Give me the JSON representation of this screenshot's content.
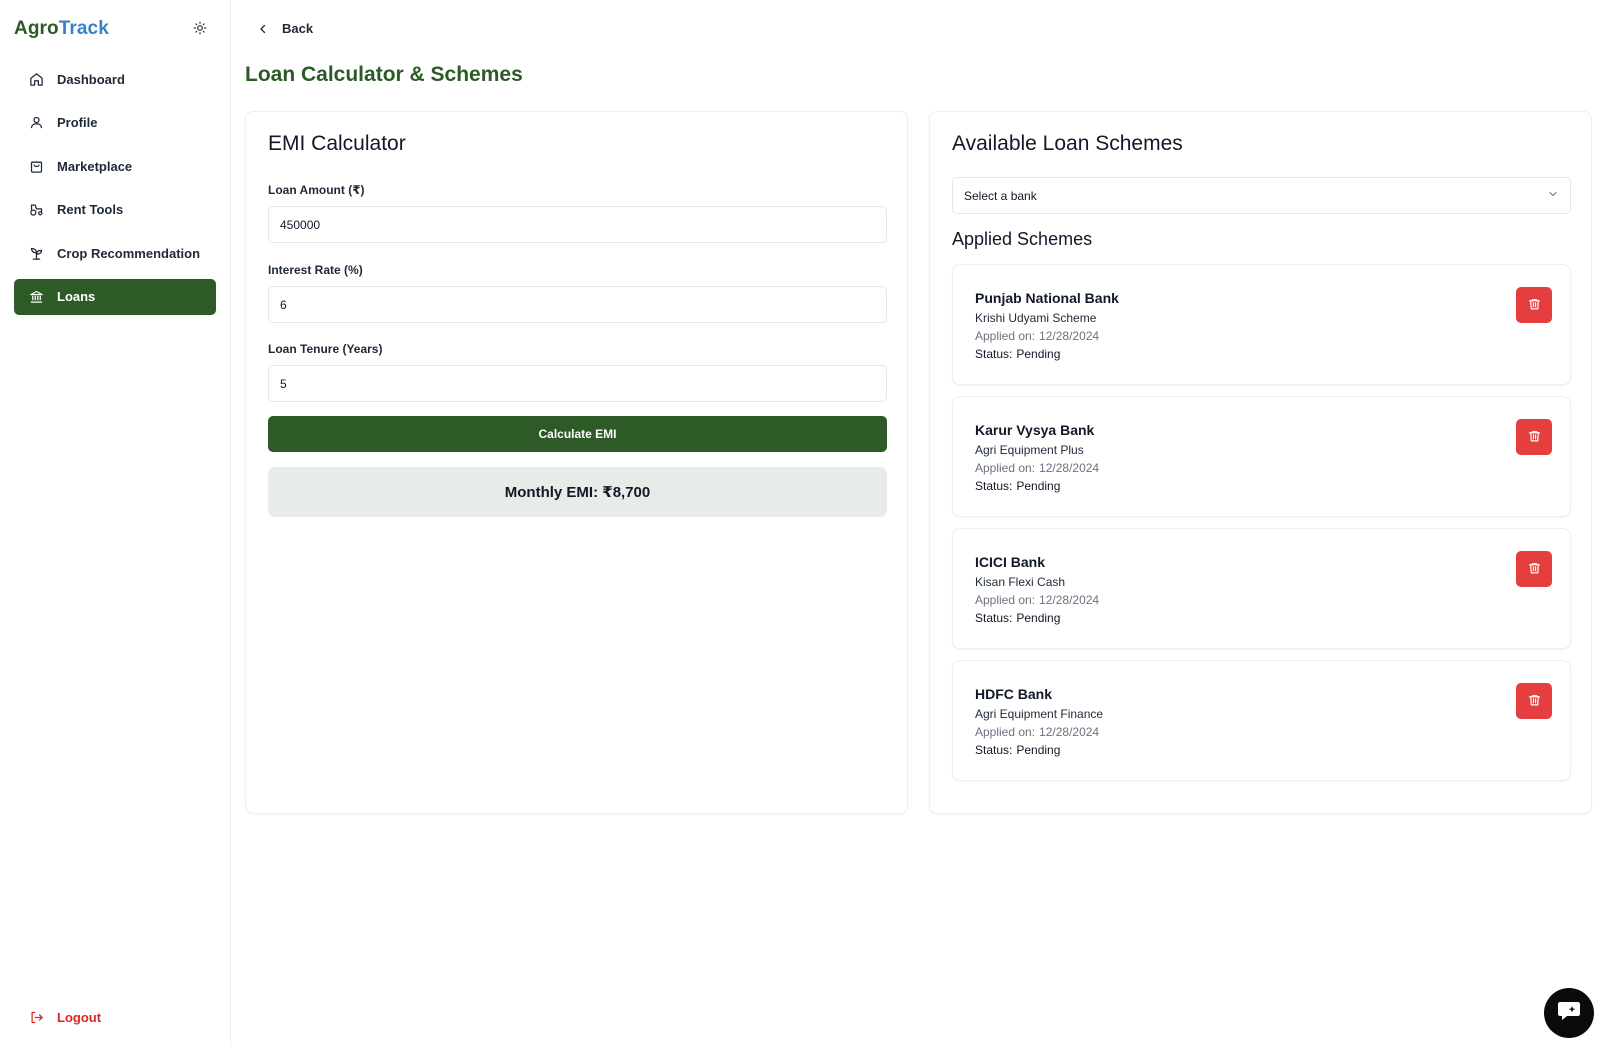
{
  "brand": {
    "part1": "Agro",
    "part2": "Track"
  },
  "sidebar": {
    "items": [
      {
        "label": "Dashboard",
        "icon": "home-icon"
      },
      {
        "label": "Profile",
        "icon": "user-icon"
      },
      {
        "label": "Marketplace",
        "icon": "shopping-bag-icon"
      },
      {
        "label": "Rent Tools",
        "icon": "tractor-icon"
      },
      {
        "label": "Crop Recommendation",
        "icon": "sprout-icon"
      },
      {
        "label": "Loans",
        "icon": "bank-icon",
        "active": true
      }
    ],
    "logout_label": "Logout"
  },
  "header": {
    "back_label": "Back",
    "title": "Loan Calculator & Schemes"
  },
  "emi": {
    "title": "EMI Calculator",
    "amount_label": "Loan Amount (₹)",
    "amount_value": "450000",
    "rate_label": "Interest Rate (%)",
    "rate_value": "6",
    "tenure_label": "Loan Tenure (Years)",
    "tenure_value": "5",
    "button_label": "Calculate EMI",
    "result": "Monthly EMI: ₹8,700"
  },
  "schemes": {
    "title": "Available Loan Schemes",
    "select_placeholder": "Select a bank",
    "applied_title": "Applied Schemes",
    "applied_label": "Applied on:",
    "status_label": "Status:",
    "items": [
      {
        "bank": "Punjab National Bank",
        "scheme": "Krishi Udyami Scheme",
        "date": "12/28/2024",
        "status": "Pending"
      },
      {
        "bank": "Karur Vysya Bank",
        "scheme": "Agri Equipment Plus",
        "date": "12/28/2024",
        "status": "Pending"
      },
      {
        "bank": "ICICI Bank",
        "scheme": "Kisan Flexi Cash",
        "date": "12/28/2024",
        "status": "Pending"
      },
      {
        "bank": "HDFC Bank",
        "scheme": "Agri Equipment Finance",
        "date": "12/28/2024",
        "status": "Pending"
      }
    ]
  },
  "colors": {
    "primary": "#2d5a27",
    "brand_blue": "#3b82c4",
    "danger": "#e53e3e",
    "result_bg": "#e8ece9"
  }
}
